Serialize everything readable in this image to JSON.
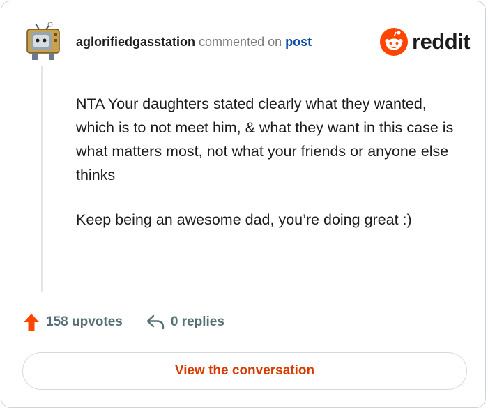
{
  "header": {
    "username": "aglorifiedgasstation",
    "action_text": "commented on",
    "post_link": "post",
    "brand_word": "reddit",
    "avatar_icon": "snoo-tv-avatar-icon",
    "brand_icon": "reddit-logo-icon"
  },
  "comment": {
    "paragraphs": [
      "NTA Your daughters stated clearly what they wanted, which is to not meet him, & what they want in this case is what matters most, not what your friends or anyone else thinks",
      "Keep being an awesome dad, you’re doing great :)"
    ]
  },
  "actions": {
    "upvotes_label": "158 upvotes",
    "replies_label": "0 replies",
    "upvote_icon": "upvote-arrow-icon",
    "reply_icon": "reply-arrow-icon"
  },
  "cta": {
    "label": "View the conversation"
  },
  "colors": {
    "reddit_orange": "#ff4500",
    "link_blue": "#0f4fa8",
    "cta_text": "#d93a00",
    "meta_gray": "#576f76"
  }
}
